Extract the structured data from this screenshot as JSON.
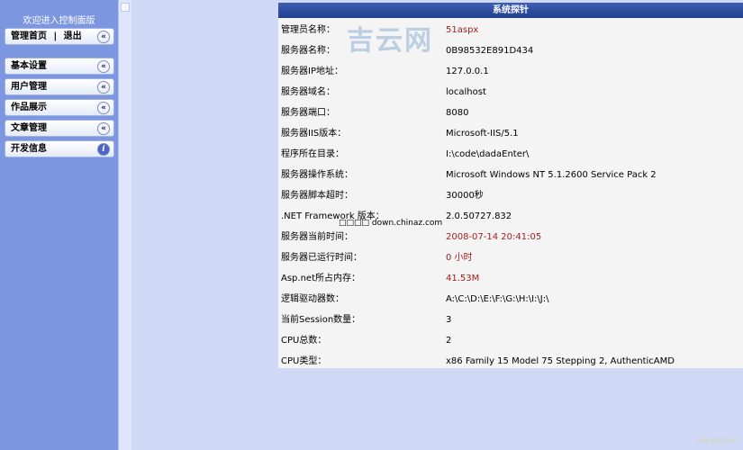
{
  "sidebar": {
    "welcome": "欢迎进入控制面版",
    "home": {
      "label1": "管理首页",
      "separator": "|",
      "label2": "退出",
      "icon": "«"
    },
    "items": [
      {
        "label": "基本设置",
        "icon": "«"
      },
      {
        "label": "用户管理",
        "icon": "«"
      },
      {
        "label": "作品展示",
        "icon": "«"
      },
      {
        "label": "文章管理",
        "icon": "«"
      },
      {
        "label": "开发信息",
        "icon": "i"
      }
    ]
  },
  "panel": {
    "title": "系统探针",
    "rows": [
      {
        "label": "管理员名称：",
        "value": "51aspx",
        "color": "#a02020"
      },
      {
        "label": "服务器名称：",
        "value": "0B98532E891D434"
      },
      {
        "label": "服务器IP地址：",
        "value": "127.0.0.1"
      },
      {
        "label": "服务器域名：",
        "value": "localhost"
      },
      {
        "label": "服务器端口：",
        "value": "8080"
      },
      {
        "label": "服务器IIS版本：",
        "value": "Microsoft-IIS/5.1"
      },
      {
        "label": "程序所在目录：",
        "value": "I:\\code\\dadaEnter\\"
      },
      {
        "label": "服务器操作系统：",
        "value": "Microsoft Windows NT 5.1.2600 Service Pack 2"
      },
      {
        "label": "服务器脚本超时：",
        "value": "30000秒"
      },
      {
        "label": ".NET Framework 版本：",
        "value": "2.0.50727.832"
      },
      {
        "label": "服务器当前时间：",
        "value": "2008-07-14 20:41:05",
        "color": "#a02020"
      },
      {
        "label": "服务器已运行时间：",
        "value": "0 小时",
        "color": "#a02020"
      },
      {
        "label": "Asp.net所占内存：",
        "value": "41.53M",
        "color": "#a02020"
      },
      {
        "label": "逻辑驱动器数：",
        "value": "A:\\C:\\D:\\E:\\F:\\G:\\H:\\I:\\J:\\"
      },
      {
        "label": "当前Session数量：",
        "value": "3"
      },
      {
        "label": "CPU总数：",
        "value": "2"
      },
      {
        "label": "CPU类型：",
        "value": "x86 Family 15 Model 75 Stepping 2, AuthenticAMD"
      }
    ]
  },
  "watermark": "吉云网",
  "overlay": "□□□□ down.chinaz.com",
  "corner": "chinaz.com"
}
